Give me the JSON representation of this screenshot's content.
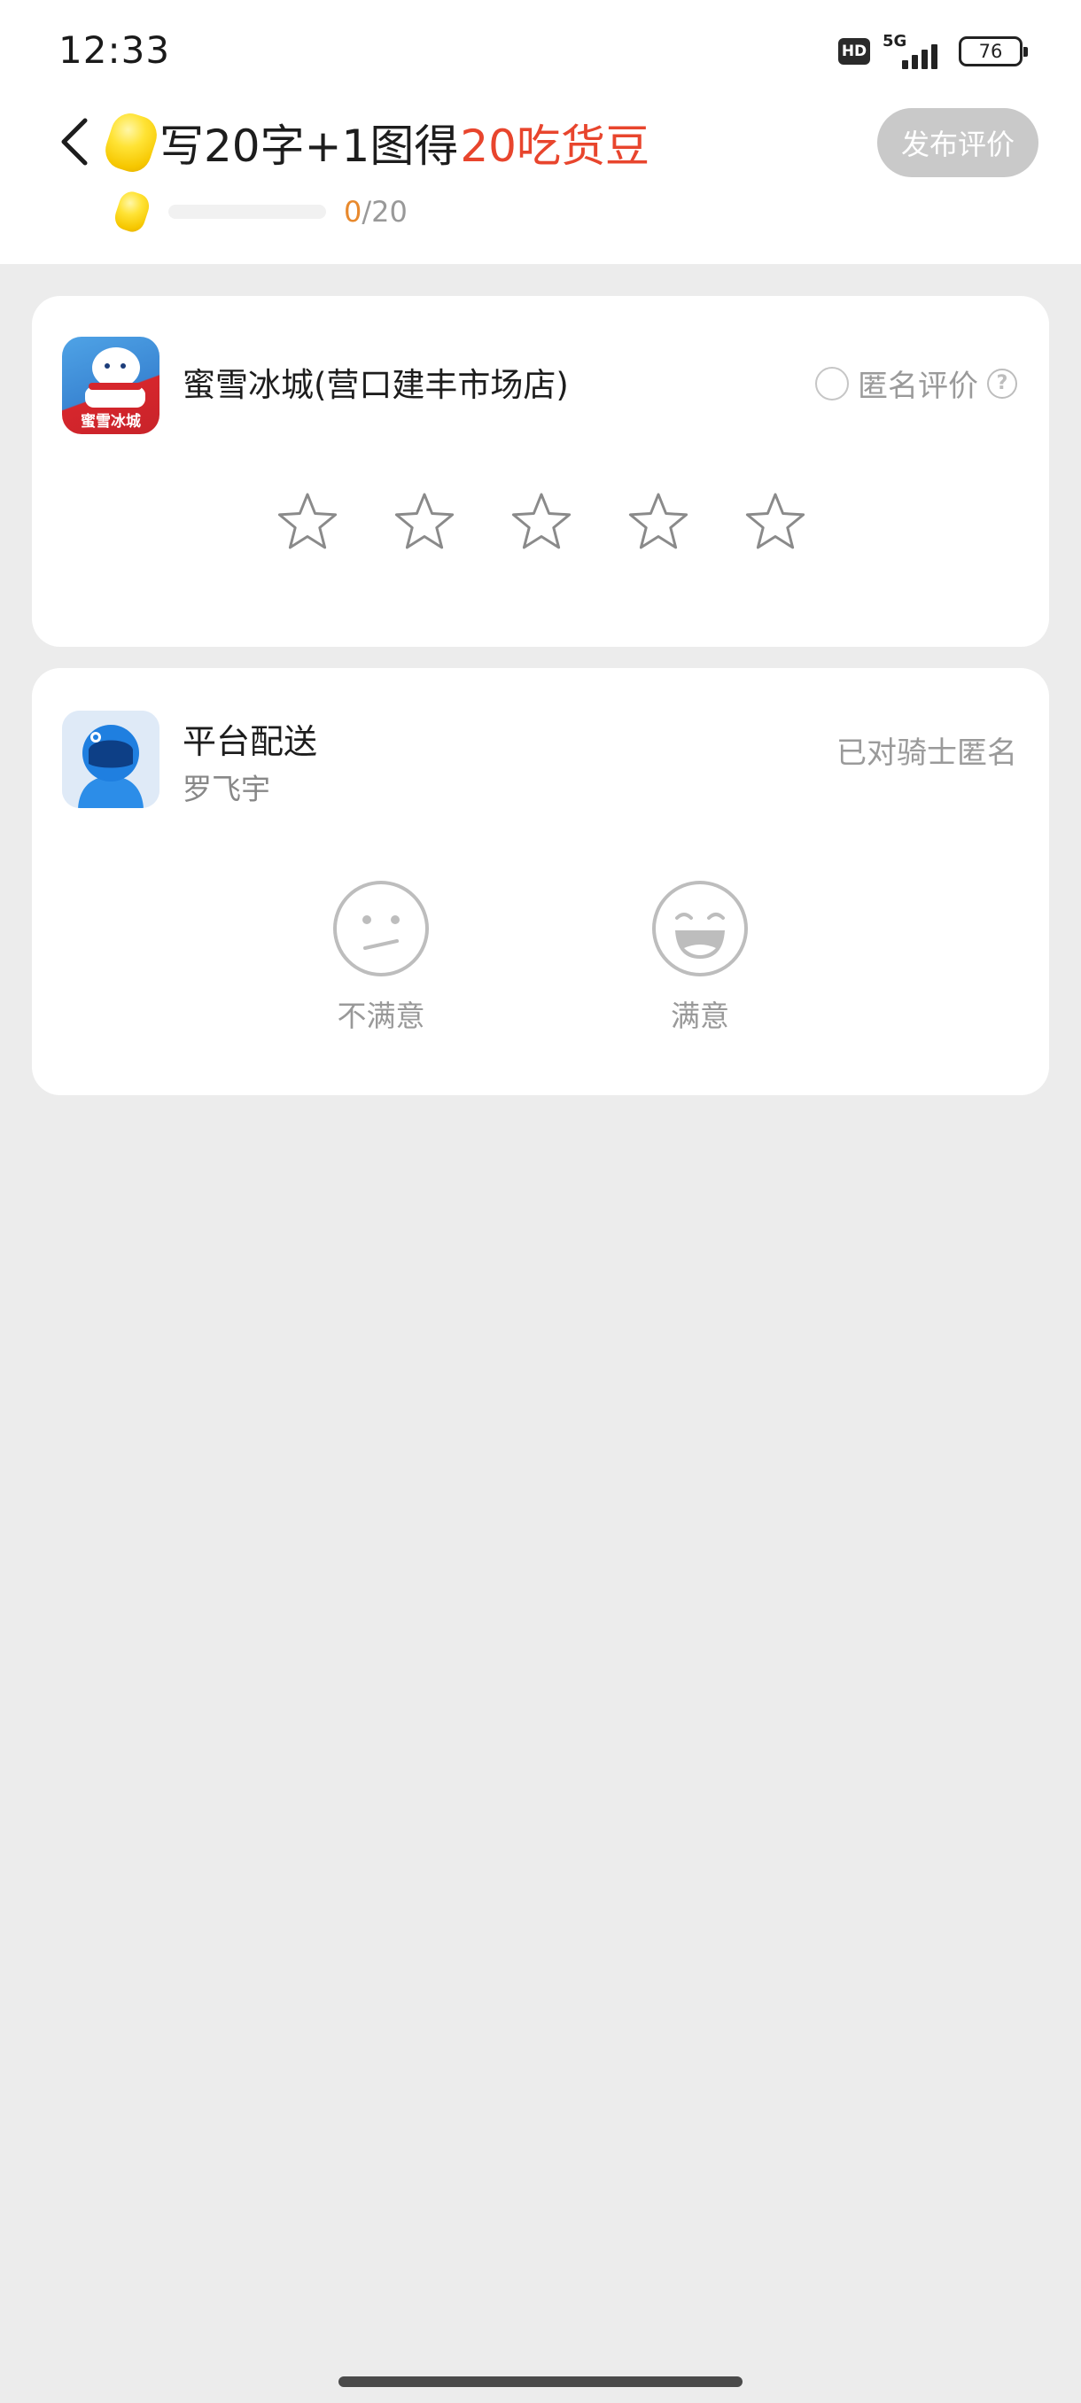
{
  "status_bar": {
    "time": "12:33",
    "hd": "HD",
    "network": "5G",
    "battery": "76"
  },
  "header": {
    "title_prefix": "写20字+1图得",
    "title_reward": "20吃货豆",
    "publish_button": "发布评价",
    "progress_current": "0",
    "progress_total": "/20",
    "progress_fraction": 0
  },
  "store": {
    "name": "蜜雪冰城(营口建丰市场店)",
    "logo_text": "蜜雪冰城",
    "anonymous_label": "匿名评价",
    "help_glyph": "?",
    "star_count": 5,
    "rating": 0
  },
  "rider": {
    "title": "平台配送",
    "name": "罗飞宇",
    "anonymous_status": "已对骑士匿名",
    "options": {
      "unsatisfied": "不满意",
      "satisfied": "满意"
    }
  },
  "colors": {
    "accent_red": "#e8452d",
    "progress_orange": "#e8892d",
    "button_disabled": "#c9c9c9",
    "background": "#ececec"
  }
}
